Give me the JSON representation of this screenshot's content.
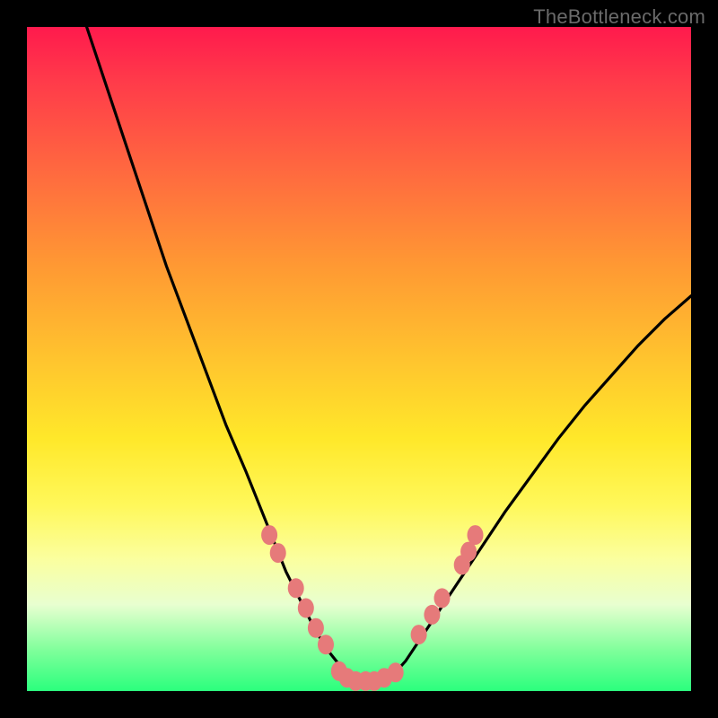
{
  "watermark": "TheBottleneck.com",
  "colors": {
    "frame": "#000000",
    "curve": "#000000",
    "marker_fill": "#e67a7a",
    "marker_stroke": "#c85f5f"
  },
  "chart_data": {
    "type": "line",
    "title": "",
    "xlabel": "",
    "ylabel": "",
    "xlim": [
      0,
      100
    ],
    "ylim": [
      0,
      100
    ],
    "grid": false,
    "legend": false,
    "series": [
      {
        "name": "bottleneck-curve",
        "x": [
          9,
          12,
          15,
          18,
          21,
          24,
          27,
          30,
          33,
          35,
          37,
          39,
          41,
          43,
          45,
          47,
          49,
          51,
          53,
          55,
          57,
          60,
          64,
          68,
          72,
          76,
          80,
          84,
          88,
          92,
          96,
          100
        ],
        "y": [
          100,
          91,
          82,
          73,
          64,
          56,
          48,
          40,
          33,
          28,
          23,
          18,
          14,
          10,
          6.5,
          4,
          2.3,
          1.5,
          1.5,
          2.3,
          4.5,
          9,
          15,
          21,
          27,
          32.5,
          38,
          43,
          47.5,
          52,
          56,
          59.5
        ]
      }
    ],
    "markers": [
      {
        "x": 36.5,
        "y": 23.5
      },
      {
        "x": 37.8,
        "y": 20.8
      },
      {
        "x": 40.5,
        "y": 15.5
      },
      {
        "x": 42.0,
        "y": 12.5
      },
      {
        "x": 43.5,
        "y": 9.5
      },
      {
        "x": 45.0,
        "y": 7.0
      },
      {
        "x": 47.0,
        "y": 3.0
      },
      {
        "x": 48.2,
        "y": 2.0
      },
      {
        "x": 49.5,
        "y": 1.5
      },
      {
        "x": 51.0,
        "y": 1.5
      },
      {
        "x": 52.3,
        "y": 1.5
      },
      {
        "x": 53.8,
        "y": 2.0
      },
      {
        "x": 55.5,
        "y": 2.8
      },
      {
        "x": 59.0,
        "y": 8.5
      },
      {
        "x": 61.0,
        "y": 11.5
      },
      {
        "x": 62.5,
        "y": 14.0
      },
      {
        "x": 65.5,
        "y": 19.0
      },
      {
        "x": 66.5,
        "y": 21.0
      },
      {
        "x": 67.5,
        "y": 23.5
      }
    ]
  }
}
